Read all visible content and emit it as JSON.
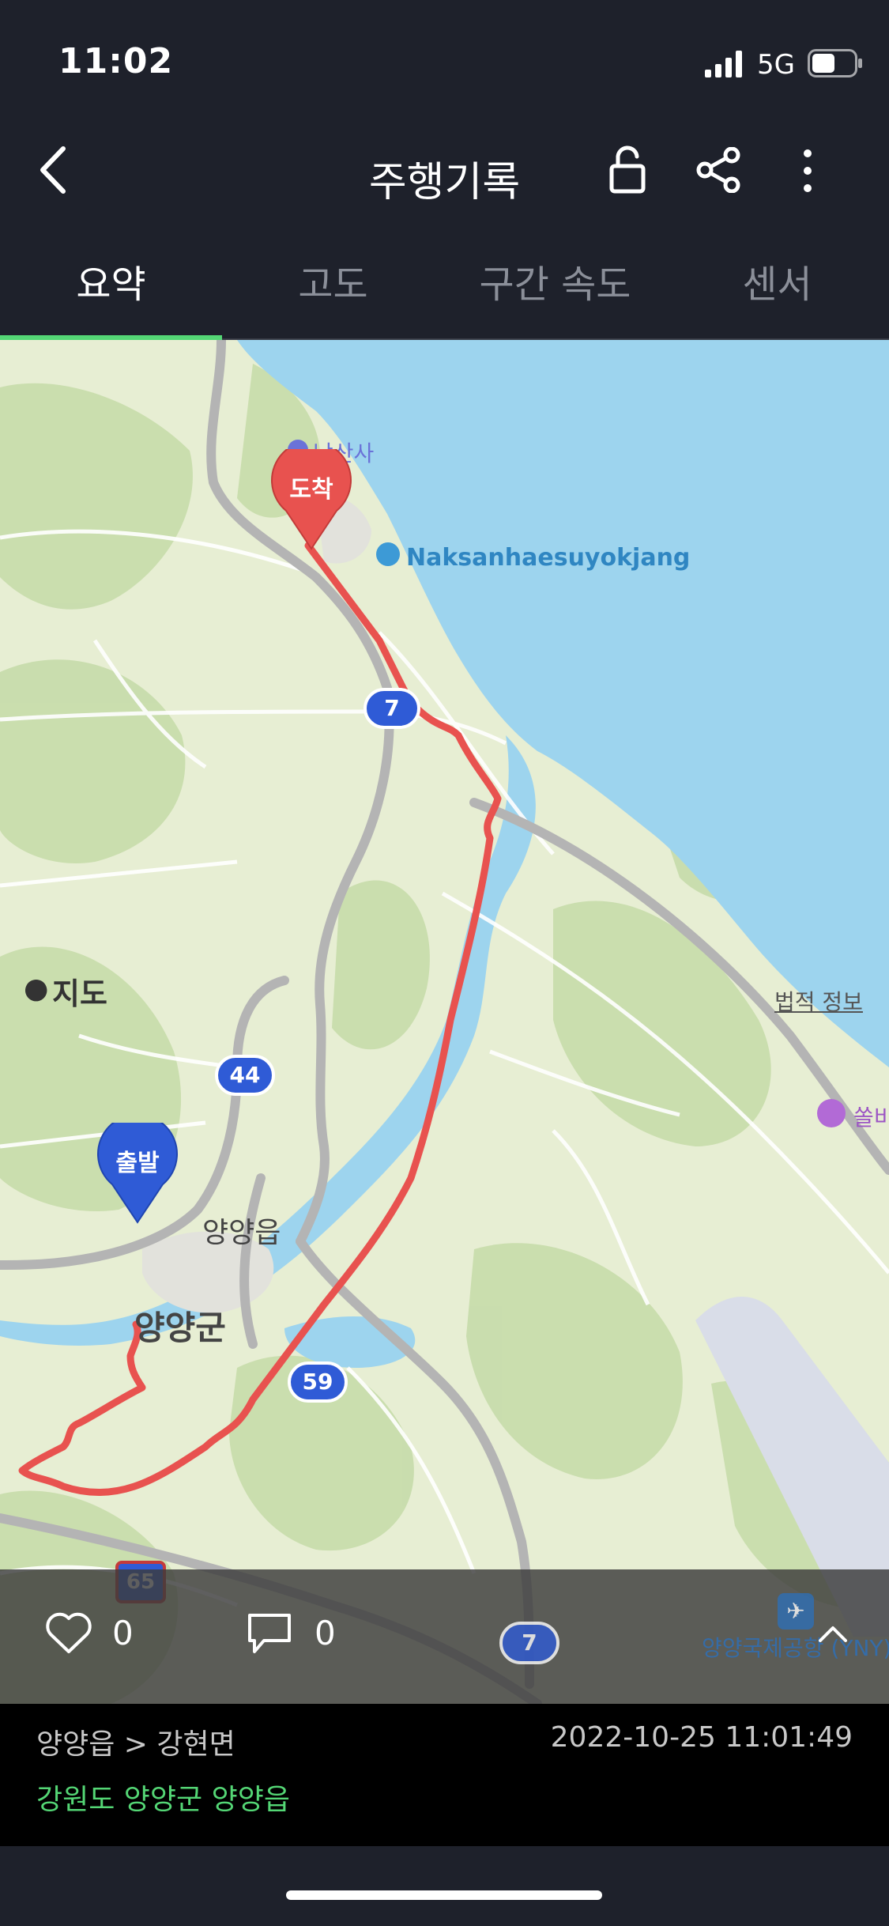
{
  "status": {
    "time": "11:02",
    "network": "5G"
  },
  "header": {
    "title": "주행기록"
  },
  "icons": {
    "back": "chevron-left-icon",
    "lock": "unlock-icon",
    "share": "share-icon",
    "more": "more-vertical-icon"
  },
  "tabs": [
    {
      "label": "요약",
      "active": true
    },
    {
      "label": "고도",
      "active": false
    },
    {
      "label": "구간 속도",
      "active": false
    },
    {
      "label": "센서",
      "active": false
    }
  ],
  "map": {
    "provider": "지도",
    "legal": "법적 정보",
    "markers": {
      "start": "출발",
      "end": "도착"
    },
    "labels": {
      "temple": "낙산사",
      "beach": "Naksanhaesuyokjang",
      "town": "양양읍",
      "county": "양양군",
      "airport": "양양국제공항 (YNY)",
      "hotel": "쏠비"
    },
    "shields": [
      "7",
      "44",
      "59",
      "65",
      "7"
    ]
  },
  "social": {
    "likes": "0",
    "comments": "0"
  },
  "ride": {
    "route": "양양읍 > 강현면",
    "datetime": "2022-10-25 11:01:49",
    "address": "강원도 양양군 양양읍"
  },
  "colors": {
    "accent": "#54d675",
    "route": "#e8524f",
    "water": "#9dd4ee",
    "start_marker": "#2f5bd6",
    "end_marker": "#e8524f"
  }
}
